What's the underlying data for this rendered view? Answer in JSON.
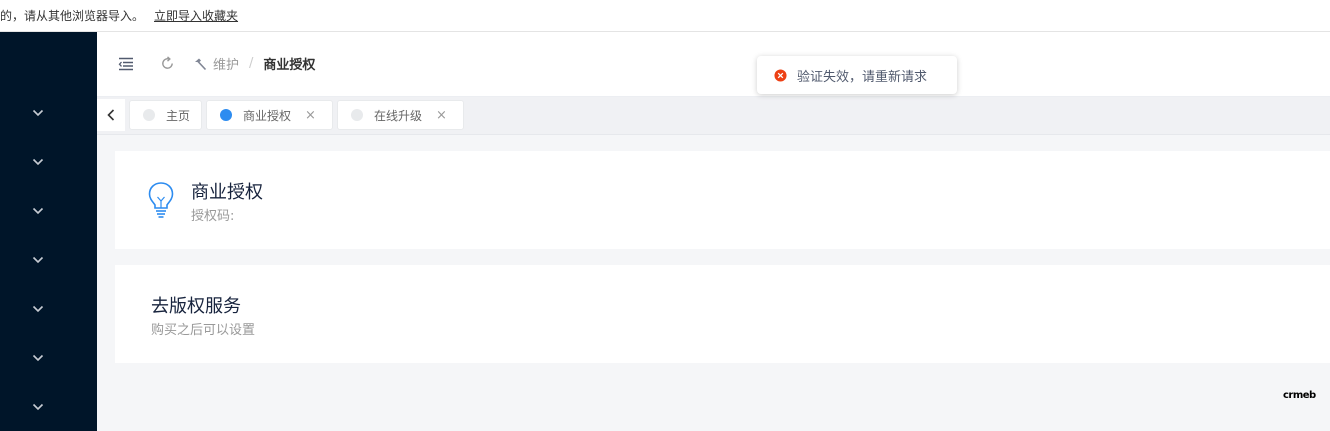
{
  "bookmark_bar": {
    "message": "的，请从其他浏览器导入。",
    "import_link": "立即导入收藏夹"
  },
  "sidebar": {
    "items": [
      {
        "icon": "chevron-down-icon"
      },
      {
        "icon": "chevron-down-icon"
      },
      {
        "icon": "chevron-down-icon"
      },
      {
        "icon": "chevron-down-icon"
      },
      {
        "icon": "chevron-down-icon"
      },
      {
        "icon": "chevron-down-icon"
      },
      {
        "icon": "chevron-down-icon"
      }
    ]
  },
  "header": {
    "breadcrumb": {
      "parent": "维护",
      "separator": "/",
      "current": "商业授权"
    }
  },
  "tabs": [
    {
      "label": "主页",
      "active": false,
      "closable": false
    },
    {
      "label": "商业授权",
      "active": true,
      "closable": true
    },
    {
      "label": "在线升级",
      "active": false,
      "closable": true
    }
  ],
  "tab_close_glyph": "×",
  "cards": {
    "license": {
      "title": "商业授权",
      "subtitle": "授权码:"
    },
    "copyright": {
      "title": "去版权服务",
      "subtitle": "购买之后可以设置"
    }
  },
  "toast": {
    "message": "验证失效，请重新请求",
    "type": "error"
  },
  "logo": {
    "text": "crmeb"
  },
  "colors": {
    "sidebar_bg": "#001529",
    "primary": "#2d8cf0",
    "error": "#ed4014",
    "bulb": "#2d8cf0"
  }
}
